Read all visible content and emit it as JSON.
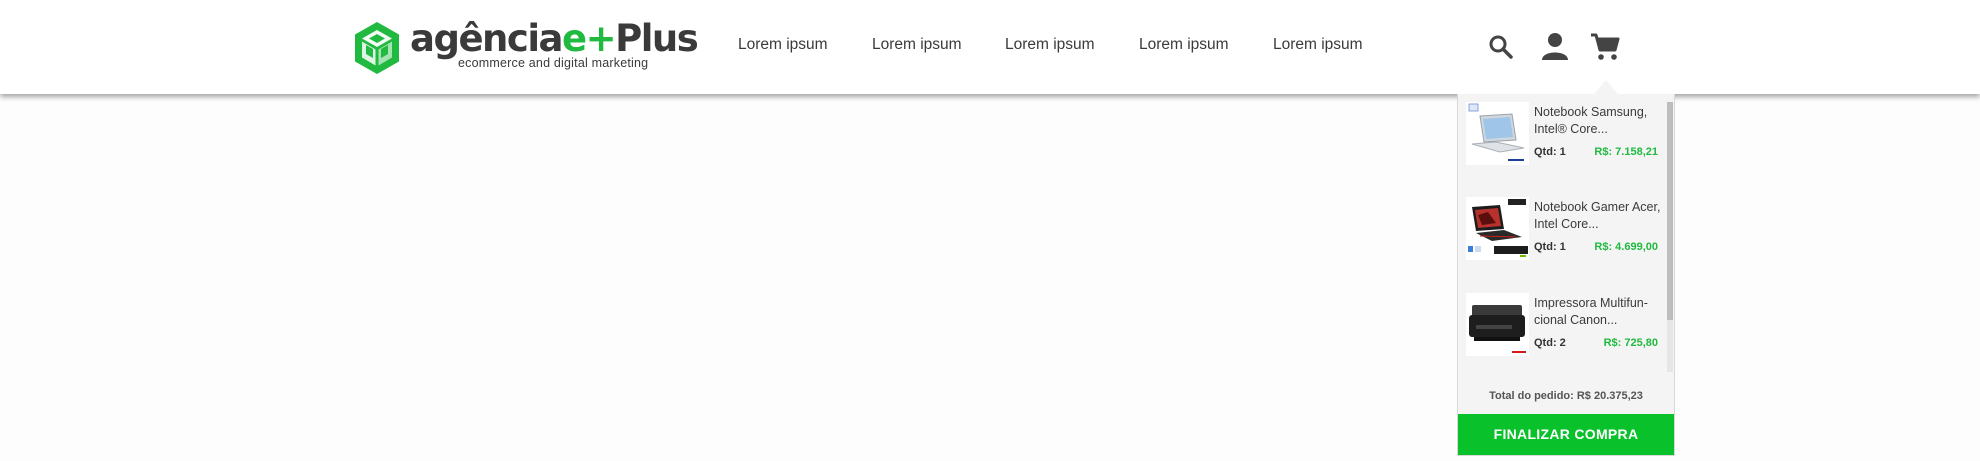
{
  "brand": {
    "name_main": "agência",
    "name_accent": "e+",
    "name_end": "Plus",
    "tagline": "ecommerce and digital marketing",
    "accent_color": "#1fba3f"
  },
  "nav": {
    "items": [
      {
        "label": "Lorem ipsum"
      },
      {
        "label": "Lorem ipsum"
      },
      {
        "label": "Lorem ipsum"
      },
      {
        "label": "Lorem ipsum"
      },
      {
        "label": "Lorem ipsum"
      }
    ]
  },
  "header_icons": [
    "search-icon",
    "user-icon",
    "cart-icon"
  ],
  "cart": {
    "items": [
      {
        "name": "Notebook Samsung, Intel® Core...",
        "qty": "Qtd: 1",
        "price": "R$: 7.158,21",
        "thumb_icon": "laptop-silver"
      },
      {
        "name": "Notebook Gamer Acer, Intel Core...",
        "qty": "Qtd: 1",
        "price": "R$: 4.699,00",
        "thumb_icon": "laptop-gamer"
      },
      {
        "name": "Impressora Multifun-cional Canon...",
        "qty": "Qtd: 2",
        "price": "R$: 725,80",
        "thumb_icon": "printer"
      }
    ],
    "total": "Total do pedido: R$ 20.375,23",
    "checkout_label": "FINALIZAR COMPRA",
    "checkout_color": "#09c12b"
  }
}
